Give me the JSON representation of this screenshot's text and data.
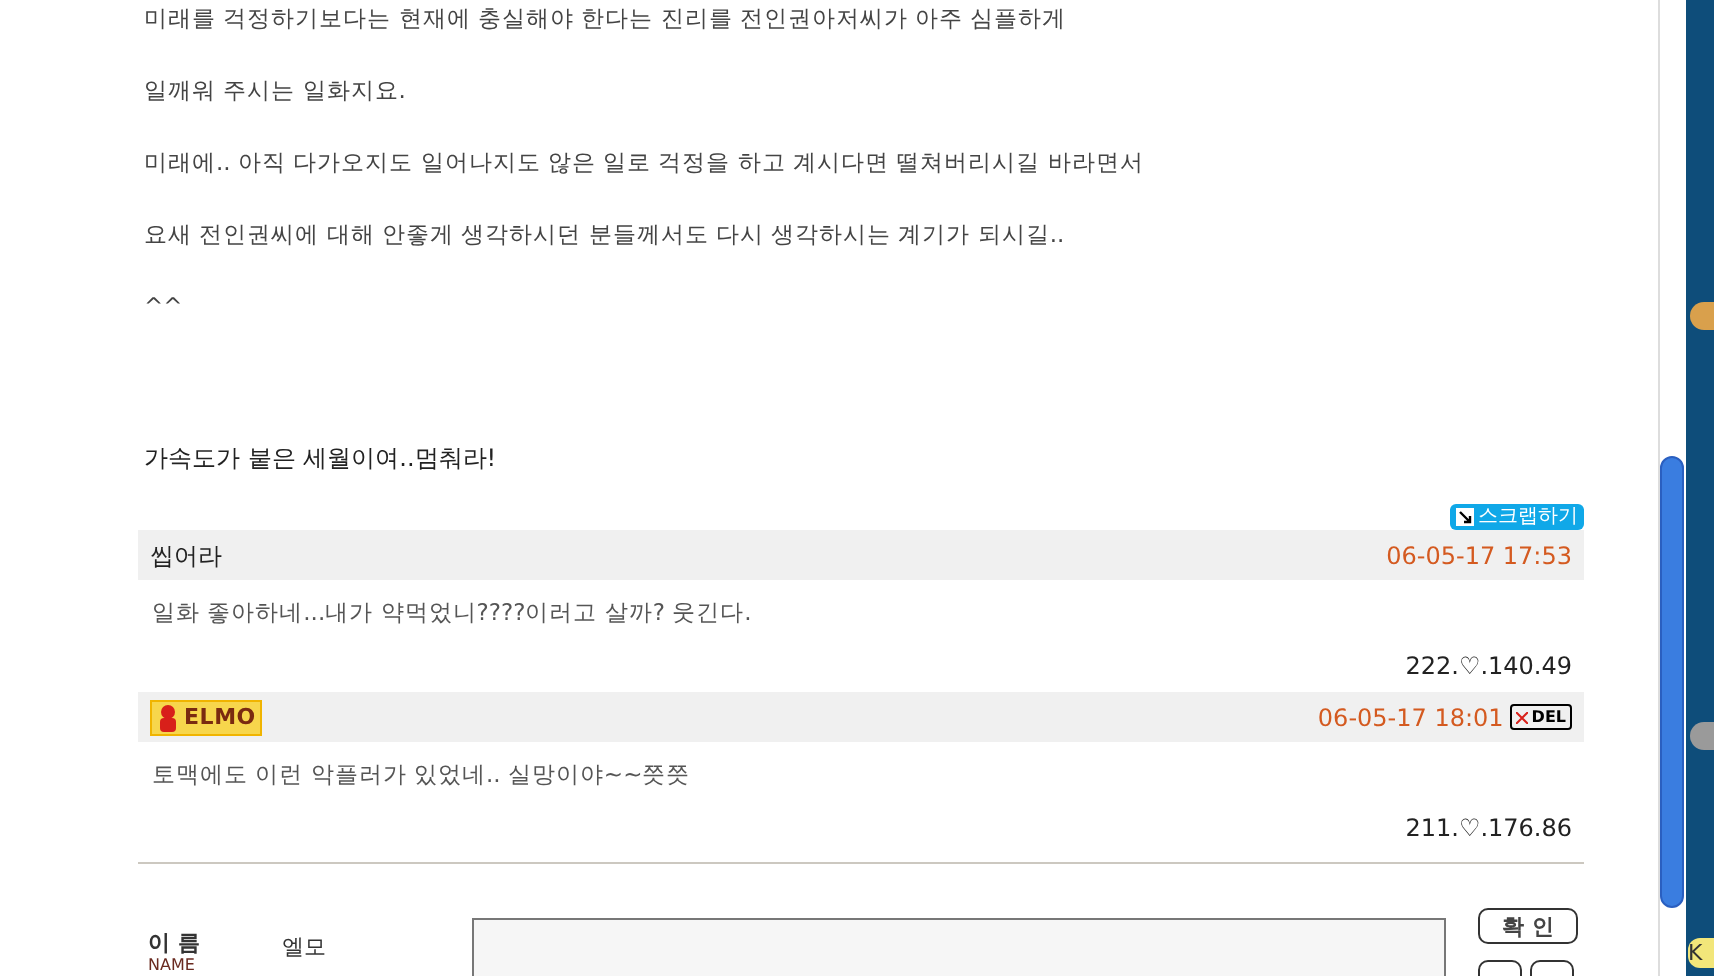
{
  "post": {
    "lines": [
      "미래를 걱정하기보다는 현재에 충실해야 한다는 진리를 전인권아저씨가 아주 심플하게",
      "일깨워 주시는 일화지요.",
      "미래에.. 아직 다가오지도 일어나지도 않은 일로 걱정을 하고 계시다면 떨쳐버리시길 바라면서",
      "요새 전인권씨에 대해 안좋게 생각하시던 분들께서도 다시 생각하시는 계기가 되시길..",
      "^^"
    ],
    "title": "가속도가 붙은 세월이여..멈춰라!",
    "scrap_button": "스크랩하기"
  },
  "comments": [
    {
      "kind": "text",
      "author": "씹어라",
      "date": "06-05-17 17:53",
      "deletable": false,
      "text": "일화 좋아하네...내가 약먹었니????이러고 살까? 웃긴다.",
      "ip": "222.♡.140.49"
    },
    {
      "kind": "badge",
      "author": "ELMO",
      "date": "06-05-17 18:01",
      "deletable": true,
      "delete_label": "DEL",
      "text": "토맥에도 이런 악플러가 있었네.. 실망이야~~쯧쯧",
      "ip": "211.♡.176.86"
    }
  ],
  "form": {
    "name_label": "이 름",
    "name_label_en": "NAME",
    "name_value": "엘모",
    "submit_button": "확 인"
  },
  "side_badge": "K"
}
